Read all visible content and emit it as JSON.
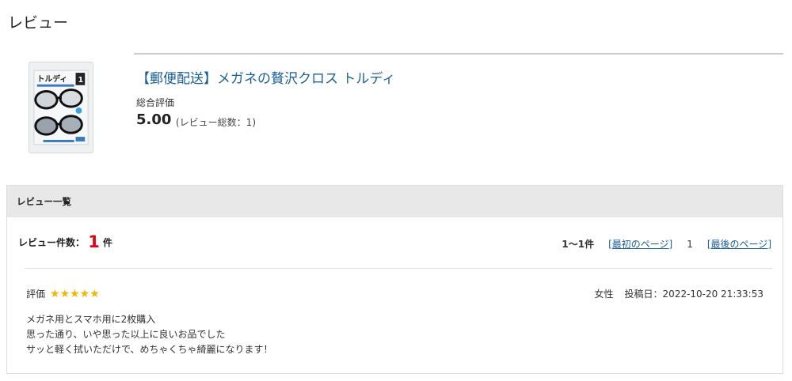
{
  "page": {
    "title": "レビュー"
  },
  "product": {
    "name": "【郵便配送】メガネの贅沢クロス トルディ",
    "image_icon": "product-package-icon",
    "image_label": "トルディ",
    "image_badge": "1",
    "overall_label": "総合評価",
    "overall_score": "5.00",
    "review_total": "(レビュー総数：1)"
  },
  "review_list": {
    "header": "レビュー一覧",
    "count_label": "レビュー件数：",
    "count_value": "1",
    "count_unit": "件",
    "pager": {
      "range": "1〜1件",
      "first_label": "[最初のページ]",
      "current_page": "1",
      "last_label": "[最後のページ]"
    }
  },
  "reviews": [
    {
      "rating_label": "評価",
      "rating": 5,
      "stars": "★★★★★",
      "gender": "女性",
      "posted": "投稿日：2022-10-20 21:33:53",
      "lines": [
        "メガネ用とスマホ用に2枚購入",
        "思った通り、いや思った以上に良いお品でした",
        "サッと軽く拭いただけで、めちゃくちゃ綺麗になります！"
      ]
    }
  ],
  "colors": {
    "accent": "#1a5f9a",
    "count": "#e60012",
    "star": "#f4b400"
  }
}
